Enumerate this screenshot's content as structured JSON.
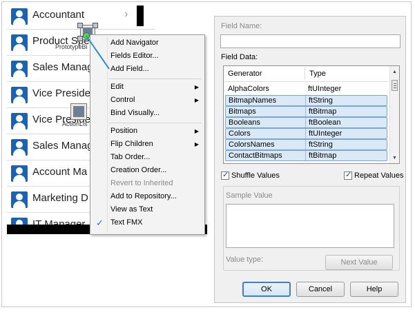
{
  "list": {
    "rows": [
      {
        "label": "Accountant",
        "chevron": "›"
      },
      {
        "label": "Product Spe"
      },
      {
        "label": "Sales Manag"
      },
      {
        "label": "Vice Preside"
      },
      {
        "label": "Vice Preside"
      },
      {
        "label": "Sales Manag"
      },
      {
        "label": "Account Ma"
      },
      {
        "label": "Marketing D"
      },
      {
        "label": "IT Manager"
      }
    ],
    "prototype_label": "PrototypeBi",
    "action_label": "ActionLis"
  },
  "context_menu": {
    "items": [
      {
        "label": "Add Navigator"
      },
      {
        "label": "Fields Editor..."
      },
      {
        "label": "Add Field..."
      },
      {
        "label": "Edit",
        "submenu": "▶"
      },
      {
        "label": "Control",
        "submenu": "▶"
      },
      {
        "label": "Bind Visually..."
      },
      {
        "label": "Position",
        "submenu": "▶"
      },
      {
        "label": "Flip Children",
        "submenu": "▶"
      },
      {
        "label": "Tab Order..."
      },
      {
        "label": "Creation Order..."
      },
      {
        "label": "Revert to Inherited"
      },
      {
        "label": "Add to Repository..."
      },
      {
        "label": "View as Text"
      },
      {
        "label": "Text FMX",
        "check": "✓"
      }
    ]
  },
  "dialog": {
    "field_name_label": "Field Name:",
    "field_name_value": "",
    "field_data_label": "Field Data:",
    "columns": {
      "generator": "Generator",
      "type": "Type"
    },
    "rows": [
      {
        "generator": "AlphaColors",
        "type": "ftUInteger"
      },
      {
        "generator": "BitmapNames",
        "type": "ftString"
      },
      {
        "generator": "Bitmaps",
        "type": "ftBitmap"
      },
      {
        "generator": "Booleans",
        "type": "ftBoolean"
      },
      {
        "generator": "Colors",
        "type": "ftUInteger"
      },
      {
        "generator": "ColorsNames",
        "type": "ftString"
      },
      {
        "generator": "ContactBitmaps",
        "type": "ftBitmap"
      }
    ],
    "scroll_up": "▲",
    "scroll_down": "▼",
    "shuffle_label": "Shuffle Values",
    "repeat_label": "Repeat Values",
    "check_mark": "✓",
    "sample_value_label": "Sample Value",
    "value_type_label": "Value type:",
    "next_value_label": "Next Value",
    "ok_label": "OK",
    "cancel_label": "Cancel",
    "help_label": "Help"
  }
}
